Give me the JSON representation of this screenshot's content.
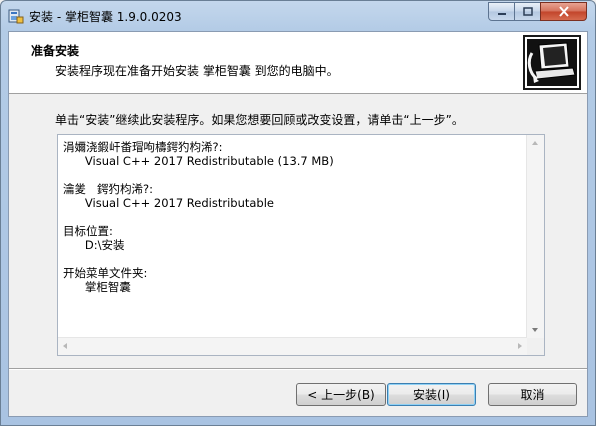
{
  "window": {
    "title": "安装 - 掌柜智囊 1.9.0.0203",
    "minimize_glyph": "—",
    "maximize_glyph": "□",
    "close_glyph": "✕"
  },
  "header": {
    "title": "准备安装",
    "subtitle": "安装程序现在准备开始安装 掌柜智囊 到您的电脑中。",
    "graphic_icon": "computer-install-icon"
  },
  "instruction": "单击“安装”继续此安装程序。如果您想要回顾或改变设置，请单击“上一步”。",
  "memo": {
    "lines": [
      "涓嬭浇鍜屽畨瑁呴檮鍔犳枃浠?:",
      "      Visual C++ 2017 Redistributable (13.7 MB)",
      "",
      "瀹夎   鍔犳枃浠?:",
      "      Visual C++ 2017 Redistributable",
      "",
      "目标位置:",
      "      D:\\安装",
      "",
      "开始菜单文件夹:",
      "      掌柜智囊"
    ]
  },
  "buttons": {
    "back": "< 上一步(B)",
    "install": "安装(I)",
    "cancel": "取消"
  }
}
